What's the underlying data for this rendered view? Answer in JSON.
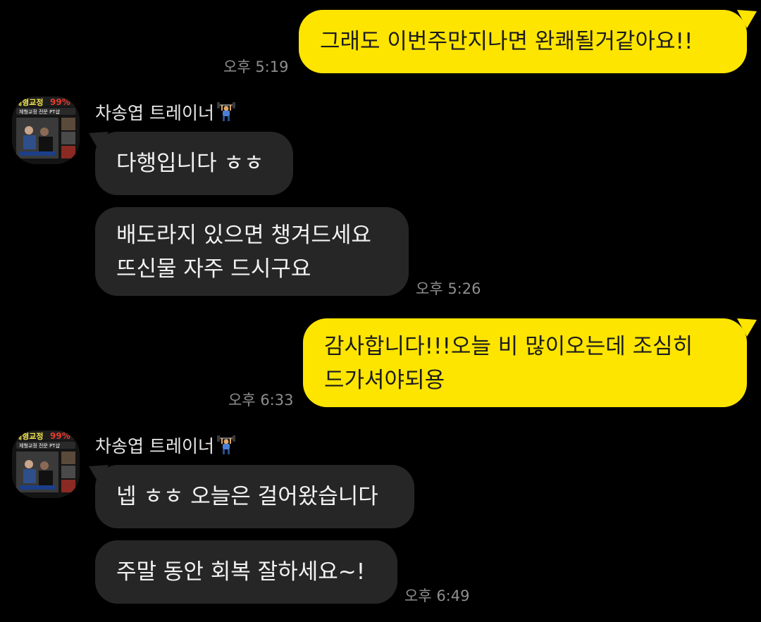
{
  "contact": {
    "name": "차송엽 트레이너",
    "name_emoji": "🏋",
    "avatar_icon": "gym-poster-avatar"
  },
  "colors": {
    "background": "#000000",
    "mine_bubble": "#fee500",
    "their_bubble": "#262626",
    "time": "#8e8e8e"
  },
  "messages": [
    {
      "sender": "me",
      "lines": [
        "그래도  이번주만지나면 완쾌될거같아요!!"
      ],
      "time": "오후 5:19"
    },
    {
      "sender": "trainer",
      "lines": [
        "다행입니다 ㅎㅎ"
      ]
    },
    {
      "sender": "trainer",
      "lines": [
        "배도라지 있으면 챙겨드세요",
        "뜨신물 자주 드시구요"
      ],
      "time": "오후 5:26"
    },
    {
      "sender": "me",
      "lines": [
        "감사합니다!!!오늘 비 많이오는데 조심히",
        "드가셔야되용"
      ],
      "time": "오후 6:33"
    },
    {
      "sender": "trainer",
      "lines": [
        "넵 ㅎㅎ 오늘은 걸어왔습니다"
      ]
    },
    {
      "sender": "trainer",
      "lines": [
        "주말 동안 회복 잘하세요~!"
      ],
      "time": "오후 6:49"
    }
  ]
}
